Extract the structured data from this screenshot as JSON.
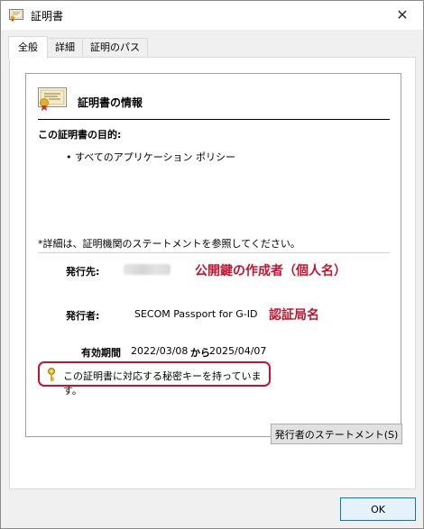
{
  "window": {
    "title": "証明書"
  },
  "tabs": [
    {
      "label": "全般"
    },
    {
      "label": "詳細"
    },
    {
      "label": "証明のパス"
    }
  ],
  "general": {
    "info_title": "証明書の情報",
    "purpose_heading": "この証明書の目的:",
    "purpose_item": "• すべてのアプリケーション ポリシー",
    "detail_note": "*詳細は、証明機関のステートメントを参照してください。",
    "issued_to_label": "発行先:",
    "issued_to_value_blurred": "Shuji Ohe",
    "issued_to_annotation": "公開鍵の作成者（個人名）",
    "issued_by_label": "発行者:",
    "issued_by_value": "SECOM Passport for G-ID",
    "issued_by_annotation": "認証局名",
    "validity_label": "有効期間",
    "validity_from": "2022/03/08",
    "validity_kara": "から",
    "validity_to": "2025/04/07",
    "private_key_note": "この証明書に対応する秘密キーを持っています。",
    "issuer_statement_button": "発行者のステートメント(S)"
  },
  "footer": {
    "ok_label": "OK"
  },
  "colors": {
    "annotation_red": "#c0152f",
    "ok_border": "#0078d7"
  }
}
